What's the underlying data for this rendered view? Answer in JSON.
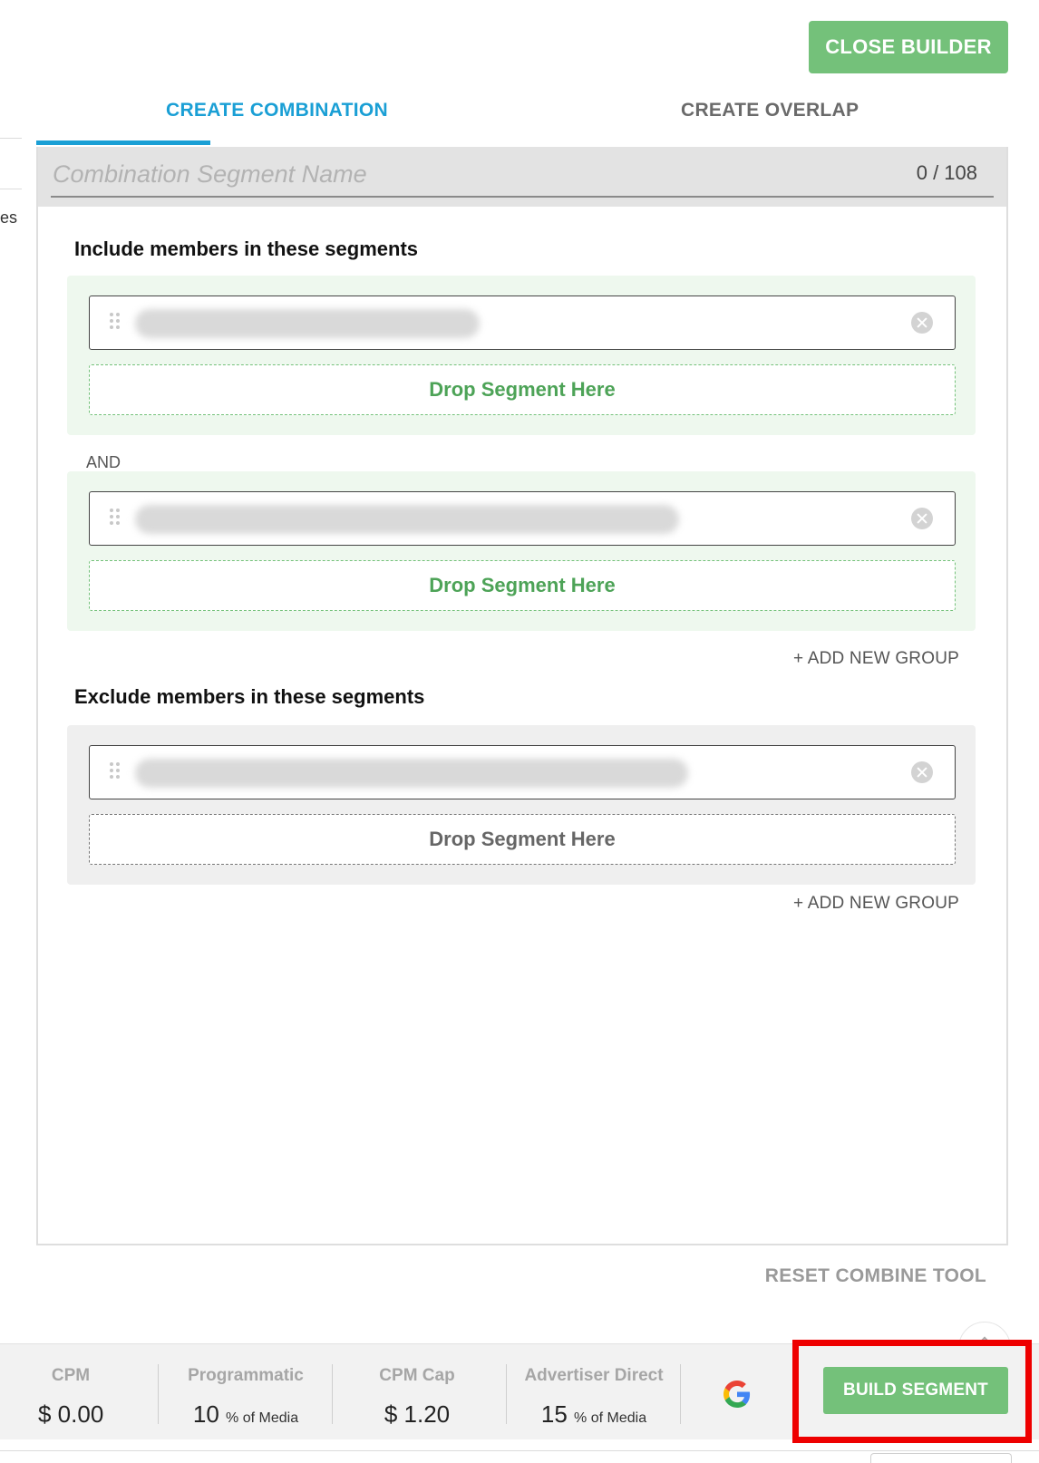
{
  "sidebar": {
    "text_fragment": "es"
  },
  "header": {
    "close_builder_label": "CLOSE BUILDER"
  },
  "tabs": [
    {
      "label": "CREATE COMBINATION",
      "active": true
    },
    {
      "label": "CREATE OVERLAP",
      "active": false
    }
  ],
  "name_field": {
    "placeholder": "Combination Segment Name",
    "value": "",
    "counter": "0 / 108"
  },
  "include": {
    "title": "Include members in these segments",
    "groups": [
      {
        "drop_label": "Drop Segment Here"
      },
      {
        "drop_label": "Drop Segment Here"
      }
    ],
    "joiner": "AND",
    "add_group_label": "+ ADD NEW GROUP"
  },
  "exclude": {
    "title": "Exclude members in these segments",
    "groups": [
      {
        "drop_label": "Drop Segment Here"
      }
    ],
    "add_group_label": "+ ADD NEW GROUP"
  },
  "reset_label": "RESET COMBINE TOOL",
  "footer": {
    "cpm": {
      "label": "CPM",
      "value": "$ 0.00"
    },
    "programmatic": {
      "label": "Programmatic",
      "value": "10",
      "unit": "% of Media"
    },
    "cpm_cap": {
      "label": "CPM Cap",
      "value": "$ 1.20"
    },
    "advertiser_direct": {
      "label": "Advertiser Direct",
      "value": "15",
      "unit": "% of Media"
    },
    "build_label": "BUILD SEGMENT"
  },
  "colors": {
    "accent_blue": "#1a9fd5",
    "button_green": "#74c17a",
    "drop_green": "#4da357",
    "include_bg": "#eef8ee",
    "highlight_red": "#ee0000"
  },
  "icons": [
    "drag-handle-icon",
    "clear-circle-icon",
    "chevron-up-icon",
    "google-logo-icon"
  ]
}
